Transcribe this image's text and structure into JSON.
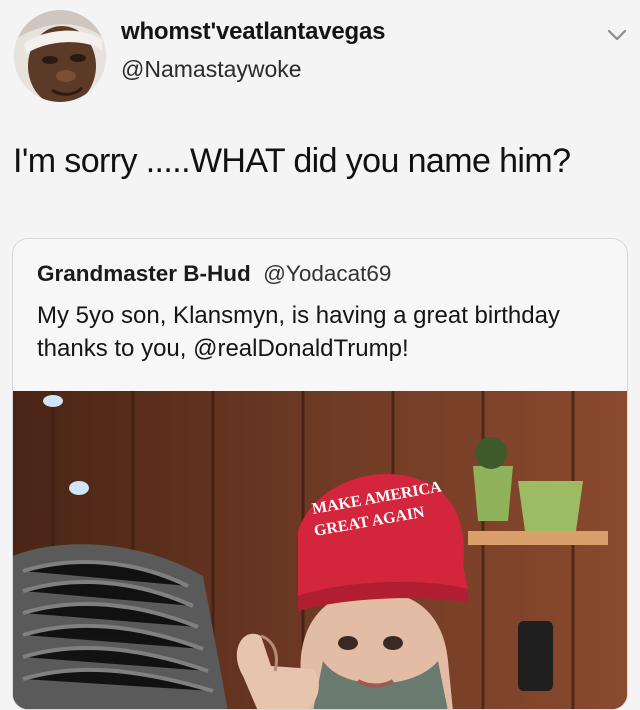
{
  "tweet": {
    "display_name": "whomst'veatlantavegas",
    "handle": "@Namastaywoke",
    "text": "I'm sorry .....WHAT did you name him?",
    "menu_icon": "chevron-down-icon"
  },
  "quoted_tweet": {
    "display_name": "Grandmaster B-Hud",
    "handle": "@Yodacat69",
    "text": "My 5yo son, Klansmyn, is having a great birthday thanks to you, @realDonaldTrump!",
    "photo": {
      "hat_line_1": "MAKE AMERICA",
      "hat_line_2": "GREAT AGAIN",
      "hat_color": "#d3253b"
    }
  }
}
